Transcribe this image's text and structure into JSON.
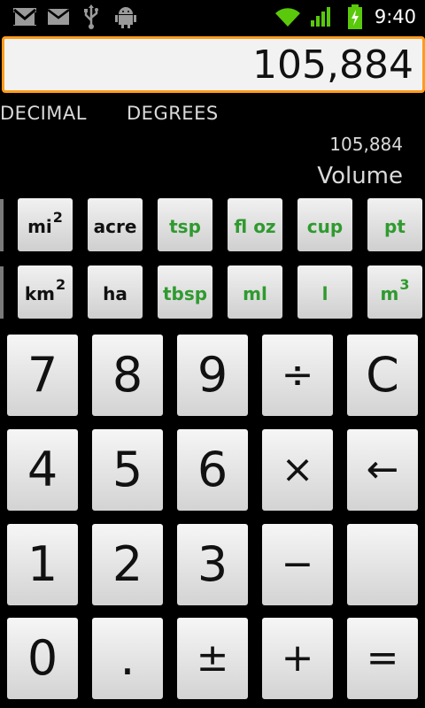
{
  "status_bar": {
    "time": "9:40",
    "icons": [
      "gmail-icon",
      "email-icon",
      "usb-icon",
      "android-debug-icon",
      "wifi-icon",
      "signal-icon",
      "battery-charging-icon"
    ]
  },
  "display": {
    "value": "105,884"
  },
  "modes": {
    "number_mode": "DECIMAL",
    "angle_mode": "DEGREES"
  },
  "result": "105,884",
  "category": "Volume",
  "units_row1": [
    {
      "label": "mi",
      "sup": "2"
    },
    {
      "label": "acre",
      "sup": ""
    },
    {
      "label": "tsp",
      "sup": ""
    },
    {
      "label": "fl oz",
      "sup": ""
    },
    {
      "label": "cup",
      "sup": ""
    },
    {
      "label": "pt",
      "sup": ""
    }
  ],
  "units_row2": [
    {
      "label": "km",
      "sup": "2"
    },
    {
      "label": "ha",
      "sup": ""
    },
    {
      "label": "tbsp",
      "sup": ""
    },
    {
      "label": "ml",
      "sup": ""
    },
    {
      "label": "l",
      "sup": ""
    },
    {
      "label": "m",
      "sup": "3"
    }
  ],
  "keypad": [
    [
      "7",
      "8",
      "9",
      "÷",
      "C"
    ],
    [
      "4",
      "5",
      "6",
      "×",
      "←"
    ],
    [
      "1",
      "2",
      "3",
      "−",
      ""
    ],
    [
      "0",
      ".",
      "±",
      "+",
      "="
    ]
  ],
  "colors": {
    "accent": "#ff9c1a",
    "unit_active": "#2f9a2f"
  }
}
